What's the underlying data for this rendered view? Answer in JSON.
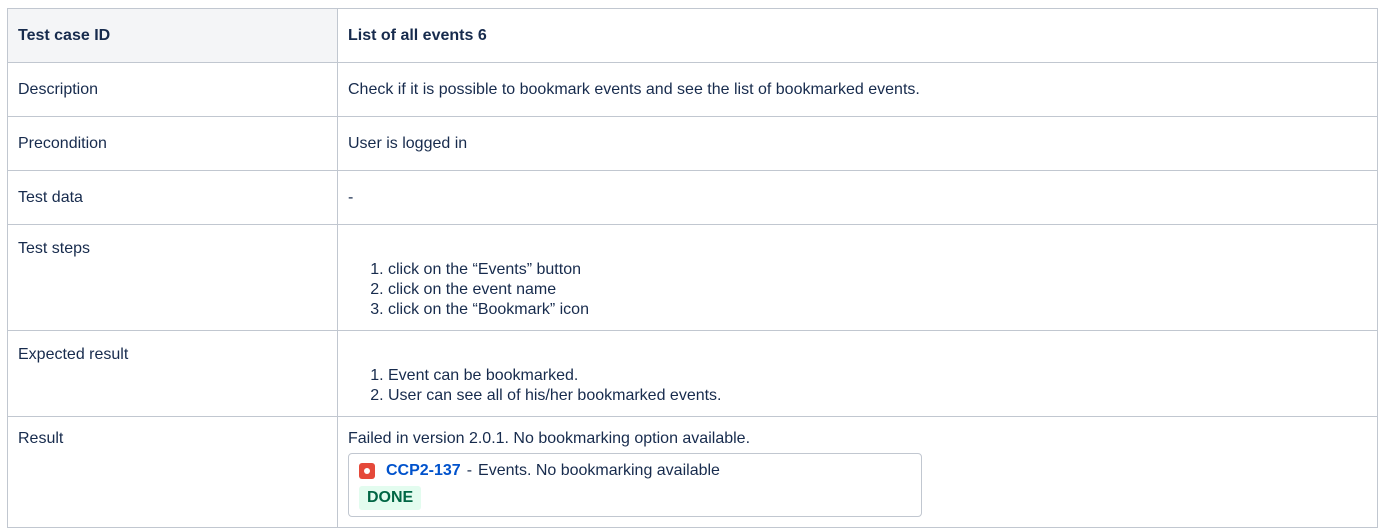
{
  "table": {
    "header": {
      "label": "Test case ID",
      "value": "List of all events 6"
    },
    "rows": {
      "description": {
        "label": "Description",
        "value": "Check if it is possible to bookmark events and see the list of bookmarked events."
      },
      "precondition": {
        "label": "Precondition",
        "value": "User is logged in"
      },
      "test_data": {
        "label": "Test data",
        "value": "-"
      },
      "test_steps": {
        "label": "Test steps",
        "items": [
          "click on the “Events” button",
          "click on the event name",
          "click on the “Bookmark” icon"
        ]
      },
      "expected_result": {
        "label": "Expected result",
        "items": [
          "Event can be bookmarked.",
          "User can see all of his/her bookmarked events."
        ]
      },
      "result": {
        "label": "Result",
        "value": "Failed in version 2.0.1. No bookmarking option available.",
        "issue": {
          "icon": "bug-icon",
          "key": "CCP2-137",
          "separator": "-",
          "summary": "Events. No bookmarking available",
          "status": "DONE",
          "status_color": "#006644",
          "status_bg": "#e3fcef"
        }
      }
    }
  },
  "colors": {
    "border": "#c1c7d0",
    "header_bg": "#f4f5f7",
    "link": "#0052cc",
    "bug_icon": "#e5493a"
  }
}
